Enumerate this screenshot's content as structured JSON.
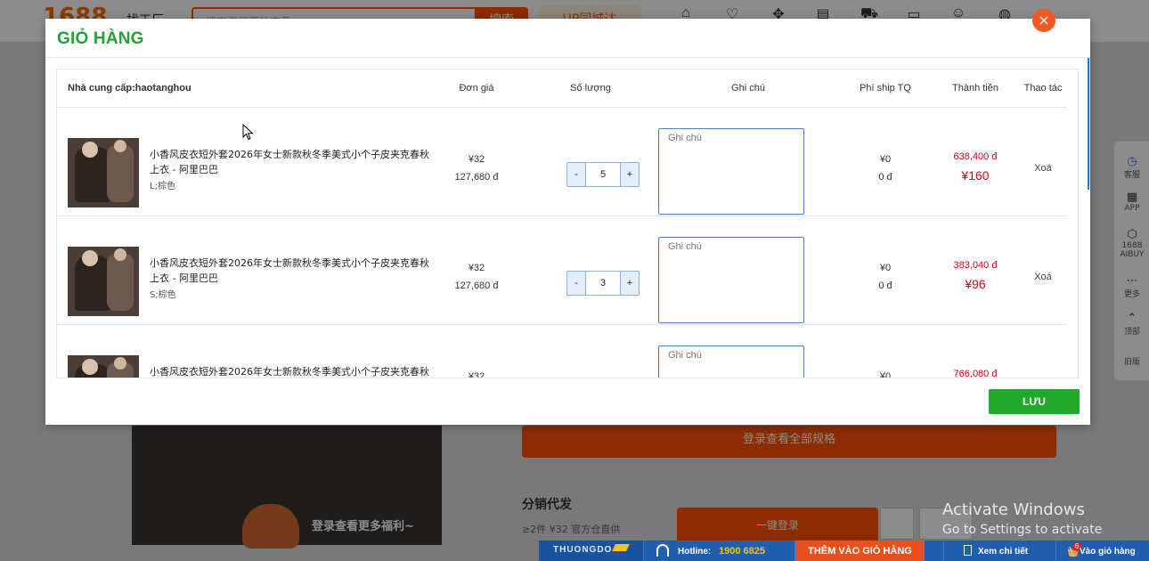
{
  "background": {
    "logo": "1688",
    "logo_sub": "找工厂",
    "search_placeholder": "搜索您想要的商品",
    "search_button": "搜索",
    "promo": "UP同城达",
    "orange_bar": "登录查看全部规格",
    "left_caption": "登录查看更多福利~",
    "section_title": "分销代发",
    "section_sub": "≥2件 ¥32  官方仓直供",
    "login_button": "一键登录",
    "sidebar": [
      {
        "icon": "clock-icon",
        "label": "客服"
      },
      {
        "icon": "grid-icon",
        "label": "APP"
      },
      {
        "icon": "ai-icon",
        "label": "1688 AIBUY"
      },
      {
        "icon": "more-icon",
        "label": "更多"
      },
      {
        "icon": "chevron-up-icon",
        "label": "顶部"
      },
      {
        "icon": "",
        "label": "旧版"
      }
    ]
  },
  "modal": {
    "title": "GIỎ HÀNG",
    "close_glyph": "×",
    "save_label": "LƯU",
    "headers": {
      "supplier": "Nhà cung cấp:haotanghou",
      "unit_price": "Đơn giá",
      "quantity": "Số lượng",
      "note": "Ghi chú",
      "shipping": "Phí ship TQ",
      "total": "Thành tiền",
      "actions": "Thao tác"
    },
    "items": [
      {
        "name": "小香风皮衣短外套2026年女士新款秋冬季美式小个子皮夹克春秋上衣 - 阿里巴巴",
        "variant": "L;棕色",
        "price_cny": "¥32",
        "price_vnd": "127,680 đ",
        "qty_minus": "-",
        "quantity": "5",
        "qty_plus": "+",
        "note_placeholder": "Ghi chú",
        "ship_cny": "¥0",
        "ship_vnd": "0 đ",
        "total_vnd": "638,400 đ",
        "total_cny": "¥160",
        "delete_label": "Xoá"
      },
      {
        "name": "小香风皮衣短外套2026年女士新款秋冬季美式小个子皮夹克春秋上衣 - 阿里巴巴",
        "variant": "S;棕色",
        "price_cny": "¥32",
        "price_vnd": "127,680 đ",
        "qty_minus": "-",
        "quantity": "3",
        "qty_plus": "+",
        "note_placeholder": "Ghi chú",
        "ship_cny": "¥0",
        "ship_vnd": "0 đ",
        "total_vnd": "383,040 đ",
        "total_cny": "¥96",
        "delete_label": "Xoá"
      },
      {
        "name": "小香风皮衣短外套2026年女士新款秋冬季美式小个子皮夹克春秋上衣 - 阿里巴巴",
        "variant": "",
        "price_cny": "¥32",
        "price_vnd": "",
        "qty_minus": "-",
        "quantity": "",
        "qty_plus": "+",
        "note_placeholder": "Ghi chú",
        "ship_cny": "¥0",
        "ship_vnd": "",
        "total_vnd": "766,080 đ",
        "total_cny": "",
        "delete_label": ""
      }
    ]
  },
  "extension_bar": {
    "logo": "THUONGDO",
    "hotline_label": "Hotline:",
    "hotline_number": "1900 6825",
    "add_to_cart": "THÊM VÀO GIỎ HÀNG",
    "view_detail": "Xem chi tiết",
    "cart_badge": "6",
    "go_to_cart": "Vào giỏ hàng"
  },
  "watermark": {
    "line1": "Activate Windows",
    "line2": "Go to Settings to activate Windows."
  },
  "colors": {
    "title_green": "#21a339",
    "save_green": "#21a92a",
    "close_orange": "#f05a22",
    "price_red": "#d0021b",
    "note_border_blue": "#4a7fc4"
  }
}
